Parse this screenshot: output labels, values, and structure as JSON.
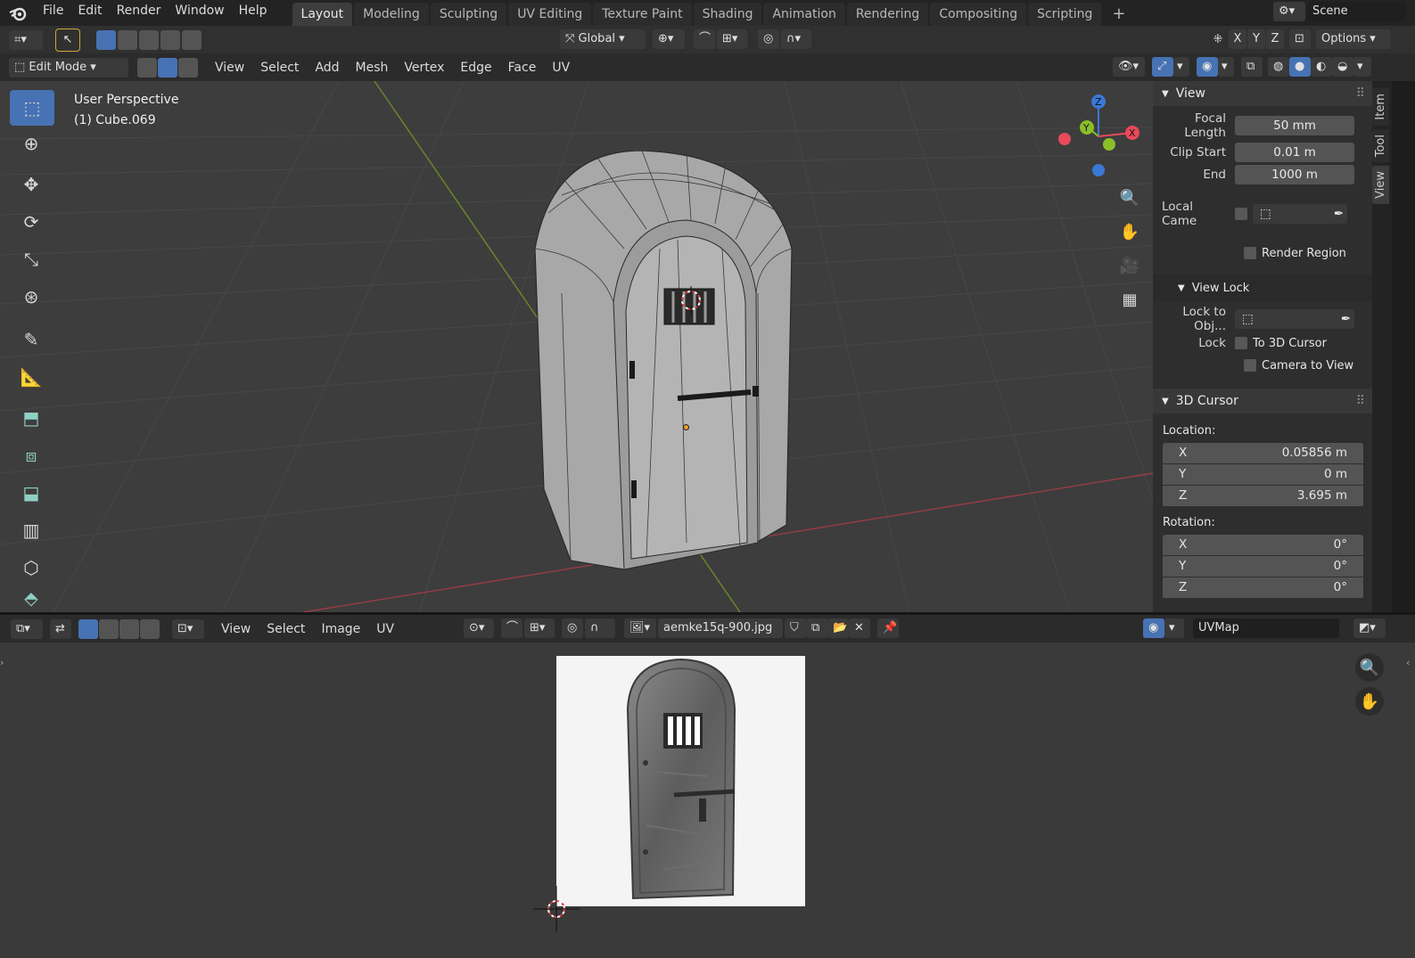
{
  "topbar": {
    "menus": [
      "File",
      "Edit",
      "Render",
      "Window",
      "Help"
    ],
    "workspaces": [
      "Layout",
      "Modeling",
      "Sculpting",
      "UV Editing",
      "Texture Paint",
      "Shading",
      "Animation",
      "Rendering",
      "Compositing",
      "Scripting"
    ],
    "active_workspace": "Layout",
    "add_tab": "+",
    "scene": "Scene"
  },
  "toolheader": {
    "orientation": "Global",
    "axes": [
      "X",
      "Y",
      "Z"
    ],
    "options": "Options"
  },
  "viewheader": {
    "mode": "Edit Mode",
    "menus": [
      "View",
      "Select",
      "Add",
      "Mesh",
      "Vertex",
      "Edge",
      "Face",
      "UV"
    ]
  },
  "viewport": {
    "title": "User Perspective",
    "object": "(1) Cube.069",
    "gizmo": {
      "z": "Z",
      "y": "Y",
      "x": "X"
    }
  },
  "npanel": {
    "tabs": [
      "Item",
      "Tool",
      "View"
    ],
    "active_tab": "View",
    "view": {
      "title": "View",
      "focal_length_label": "Focal Length",
      "focal_length": "50 mm",
      "clip_start_label": "Clip Start",
      "clip_start": "0.01 m",
      "end_label": "End",
      "end": "1000 m",
      "local_camera_label": "Local Came",
      "render_region": "Render Region",
      "view_lock_title": "View Lock",
      "lock_to_obj_label": "Lock to Obj...",
      "lock_label": "Lock",
      "to_3d_cursor": "To 3D Cursor",
      "camera_to_view": "Camera to View"
    },
    "cursor": {
      "title": "3D Cursor",
      "location_label": "Location:",
      "location": [
        {
          "axis": "X",
          "value": "0.05856 m"
        },
        {
          "axis": "Y",
          "value": "0 m"
        },
        {
          "axis": "Z",
          "value": "3.695 m"
        }
      ],
      "rotation_label": "Rotation:",
      "rotation": [
        {
          "axis": "X",
          "value": "0°"
        },
        {
          "axis": "Y",
          "value": "0°"
        },
        {
          "axis": "Z",
          "value": "0°"
        }
      ]
    }
  },
  "imgheader": {
    "menus": [
      "View",
      "Select",
      "Image",
      "UV"
    ],
    "image_name": "aemke15q-900.jpg",
    "uvmap": "UVMap"
  },
  "colors": {
    "accent": "#4772b3",
    "axis_x": "#e8495b",
    "axis_y": "#8bbf2a",
    "axis_z": "#3a78d6"
  }
}
